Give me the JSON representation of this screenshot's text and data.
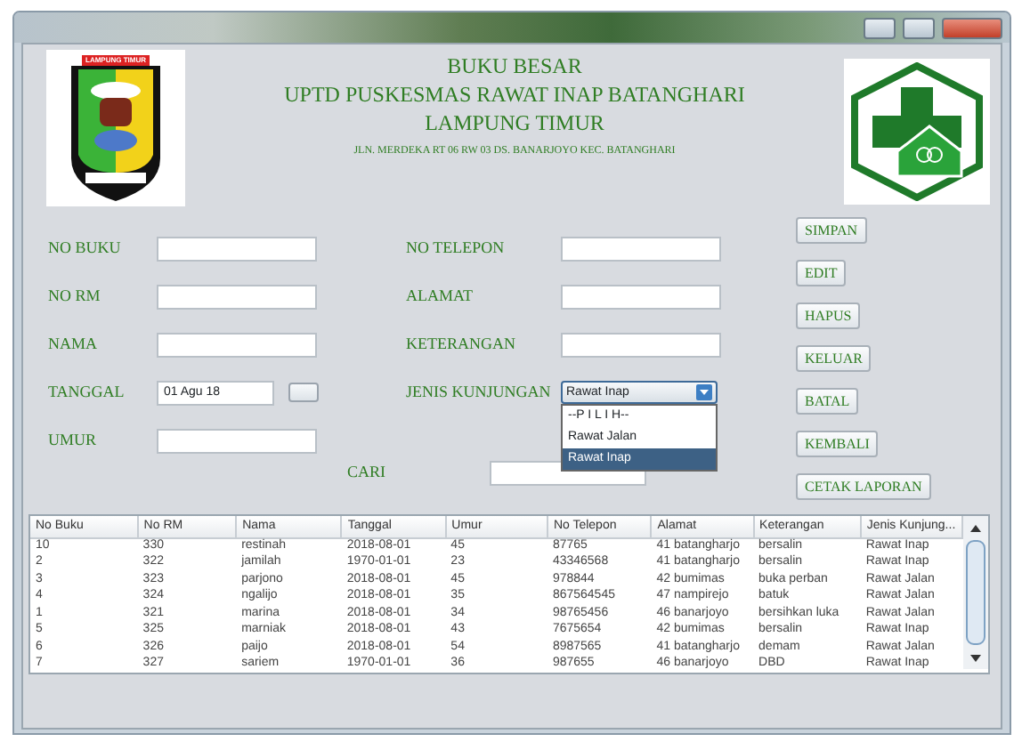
{
  "header": {
    "logo_banner": "LAMPUNG TIMUR",
    "title": "BUKU BESAR",
    "subtitle": "UPTD PUSKESMAS RAWAT INAP BATANGHARI",
    "region": "LAMPUNG TIMUR",
    "address": "JLN. MERDEKA RT 06 RW 03 DS. BANARJOYO KEC. BATANGHARI"
  },
  "form": {
    "left": [
      {
        "label": "NO BUKU",
        "kind": "text"
      },
      {
        "label": "NO RM",
        "kind": "text"
      },
      {
        "label": "NAMA",
        "kind": "text"
      },
      {
        "label": "TANGGAL",
        "kind": "date",
        "value": "01 Agu 18"
      },
      {
        "label": "UMUR",
        "kind": "text"
      }
    ],
    "right": [
      {
        "label": "NO TELEPON",
        "kind": "text"
      },
      {
        "label": "ALAMAT",
        "kind": "text"
      },
      {
        "label": "KETERANGAN",
        "kind": "text"
      },
      {
        "label": "JENIS KUNJUNGAN",
        "kind": "combo",
        "value": "Rawat Inap",
        "expanded": true,
        "options": [
          {
            "label": "--P I L I H--",
            "selected": false
          },
          {
            "label": "Rawat Jalan",
            "selected": false
          },
          {
            "label": "Rawat Inap",
            "selected": true
          }
        ]
      }
    ]
  },
  "buttons": [
    "SIMPAN",
    "EDIT",
    "HAPUS",
    "KELUAR",
    "BATAL",
    "KEMBALI",
    "CETAK LAPORAN"
  ],
  "search": {
    "label": "CARI"
  },
  "table": {
    "columns": [
      "No Buku",
      "No RM",
      "Nama",
      "Tanggal",
      "Umur",
      "No Telepon",
      "Alamat",
      "Keterangan",
      "Jenis Kunjung..."
    ],
    "rows": [
      [
        "10",
        "330",
        "restinah",
        "2018-08-01",
        "45",
        "87765",
        "41 batangharjo",
        "bersalin",
        "Rawat Inap"
      ],
      [
        "2",
        "322",
        "jamilah",
        "1970-01-01",
        "23",
        "43346568",
        "41 batangharjo",
        "bersalin",
        "Rawat Inap"
      ],
      [
        "3",
        "323",
        "parjono",
        "2018-08-01",
        "45",
        "978844",
        "42 bumimas",
        "buka perban",
        "Rawat Jalan"
      ],
      [
        "4",
        "324",
        "ngalijo",
        "2018-08-01",
        "35",
        "867564545",
        "47 nampirejo",
        "batuk",
        "Rawat Jalan"
      ],
      [
        "1",
        "321",
        "marina",
        "2018-08-01",
        "34",
        "98765456",
        "46 banarjoyo",
        "bersihkan luka",
        "Rawat Jalan"
      ],
      [
        "5",
        "325",
        "marniak",
        "2018-08-01",
        "43",
        "7675654",
        "42 bumimas",
        "bersalin",
        "Rawat Inap"
      ],
      [
        "6",
        "326",
        "paijo",
        "2018-08-01",
        "54",
        "8987565",
        "41 batangharjo",
        "demam",
        "Rawat Jalan"
      ],
      [
        "7",
        "327",
        "sariem",
        "1970-01-01",
        "36",
        "987655",
        "46 banarjoyo",
        "DBD",
        "Rawat Inap"
      ]
    ]
  }
}
